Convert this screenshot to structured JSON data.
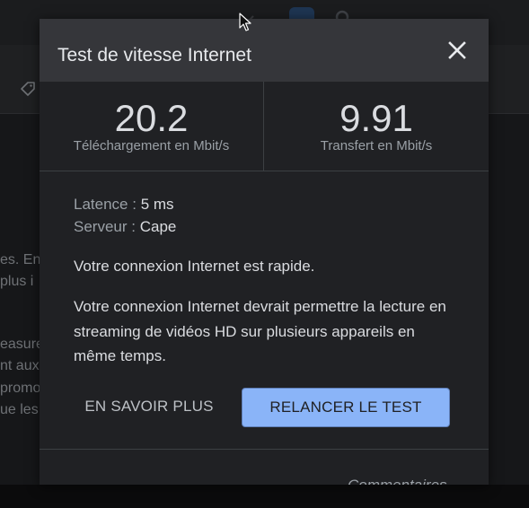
{
  "background": {
    "text_lines": [
      "es. En",
      "plus i",
      "easure",
      "nt aux",
      "promo",
      "ue les"
    ]
  },
  "dialog": {
    "title": "Test de vitesse Internet",
    "download": {
      "value": "20.2",
      "label": "Téléchargement en Mbit/s"
    },
    "upload": {
      "value": "9.91",
      "label": "Transfert en Mbit/s"
    },
    "latency": {
      "label": "Latence :",
      "value": "5 ms"
    },
    "server": {
      "label": "Serveur :",
      "value": "Cape"
    },
    "summary": "Votre connexion Internet est rapide.",
    "detail": "Votre connexion Internet devrait permettre la lecture en streaming de vidéos HD sur plusieurs appareils en même temps.",
    "learn_more_label": "EN SAVOIR PLUS",
    "retest_label": "RELANCER LE TEST",
    "feedback_label": "Commentaires"
  },
  "icons": {
    "close": "close-icon",
    "tag": "tag-icon",
    "search": "search-icon",
    "cursor": "mouse-cursor-icon"
  },
  "colors": {
    "accent": "#8ab4f8",
    "dialog_bg": "#202124",
    "header_bg": "#35363a"
  }
}
